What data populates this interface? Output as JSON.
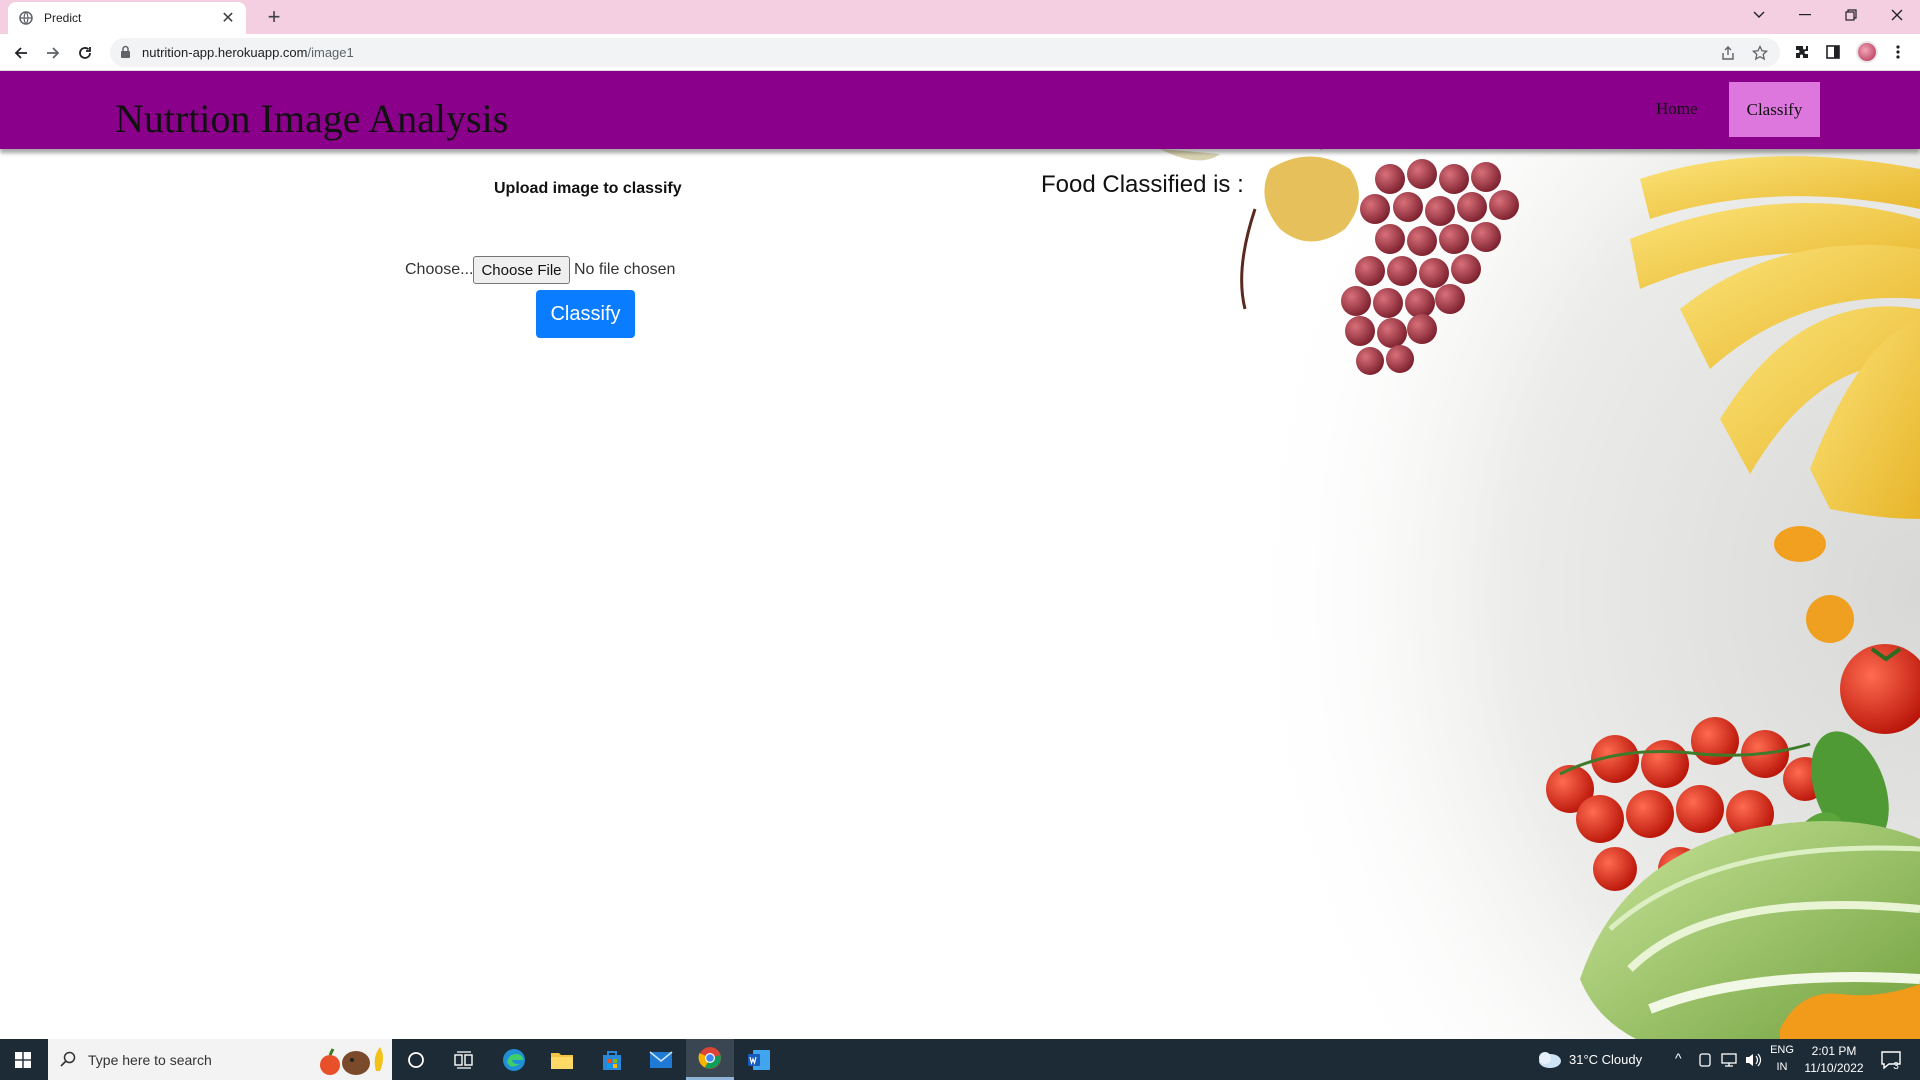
{
  "browser": {
    "tab_title": "Predict",
    "url_host": "nutrition-app.herokuapp.com",
    "url_path": "/image1"
  },
  "page": {
    "brand": "Nutrtion Image Analysis",
    "nav": [
      {
        "label": "Home",
        "active": false
      },
      {
        "label": "Classify",
        "active": true
      }
    ],
    "upload_title": "Upload image to classify",
    "file_label": "Choose...",
    "file_button": "Choose File",
    "file_status": "No file chosen",
    "classify_button": "Classify",
    "result_label": "Food Classified is :"
  },
  "taskbar": {
    "search_placeholder": "Type here to search",
    "weather": "31°C  Cloudy",
    "lang_top": "ENG",
    "lang_bottom": "IN",
    "time": "2:01 PM",
    "date": "11/10/2022",
    "notification_count": "3"
  },
  "colors": {
    "navbar": "#8b008b",
    "nav_active": "#dd77dd",
    "classify_button": "#0a7cff",
    "tabstrip": "#f4cfe2"
  }
}
